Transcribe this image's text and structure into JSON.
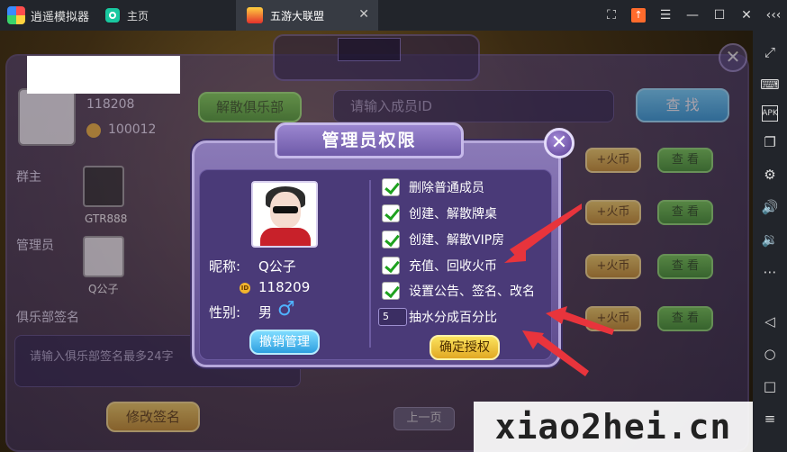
{
  "emulator": {
    "app_name": "逍遥模拟器",
    "home_tab": "主页",
    "game_tab": "五游大联盟",
    "window_controls": [
      "fullscreen-icon",
      "update-icon",
      "menu-icon",
      "minimize-icon",
      "maximize-icon",
      "close-icon",
      "collapse-icon"
    ],
    "sidebar_icons": [
      "expand-icon",
      "keyboard-icon",
      "apk-icon",
      "multi-window-icon",
      "settings-icon",
      "volume-up-icon",
      "volume-down-icon",
      "more-icon",
      "back-icon",
      "home-icon",
      "recents-icon",
      "menu-icon"
    ]
  },
  "club": {
    "club_number": "118208",
    "club_id": "100012",
    "dissolve_label": "解散俱乐部",
    "owner_heading": "群主",
    "owner_name": "GTR888",
    "admin_heading": "管理员",
    "admin_name": "Q公子",
    "sign_heading": "俱乐部签名",
    "sign_placeholder": "请输入俱乐部签名最多24字",
    "modify_sign_label": "修改签名",
    "search_placeholder": "请输入成员ID",
    "search_label": "查 找",
    "add_coin_label": "+火币",
    "view_label": "查 看",
    "prev_page_label": "上一页"
  },
  "modal": {
    "title": "管理员权限",
    "nickname_label": "昵称:",
    "nickname": "Q公子",
    "member_id": "118209",
    "gender_label": "性别:",
    "gender": "男",
    "revoke_label": "撤销管理",
    "permissions": [
      {
        "label": "删除普通成员",
        "checked": true
      },
      {
        "label": "创建、解散牌桌",
        "checked": true
      },
      {
        "label": "创建、解散VIP房",
        "checked": true
      },
      {
        "label": "充值、回收火币",
        "checked": true
      },
      {
        "label": "设置公告、签名、改名",
        "checked": true
      }
    ],
    "commission_value": "5",
    "commission_label": "抽水分成百分比",
    "grant_label": "确定授权"
  },
  "watermark": "xiao2hei.cn",
  "colors": {
    "accent_purple": "#5d4b8d",
    "check_green": "#1ea11e",
    "grant_gold": "#e1a823",
    "revoke_blue": "#2d9fe0",
    "arrow_red": "#e8343c"
  }
}
